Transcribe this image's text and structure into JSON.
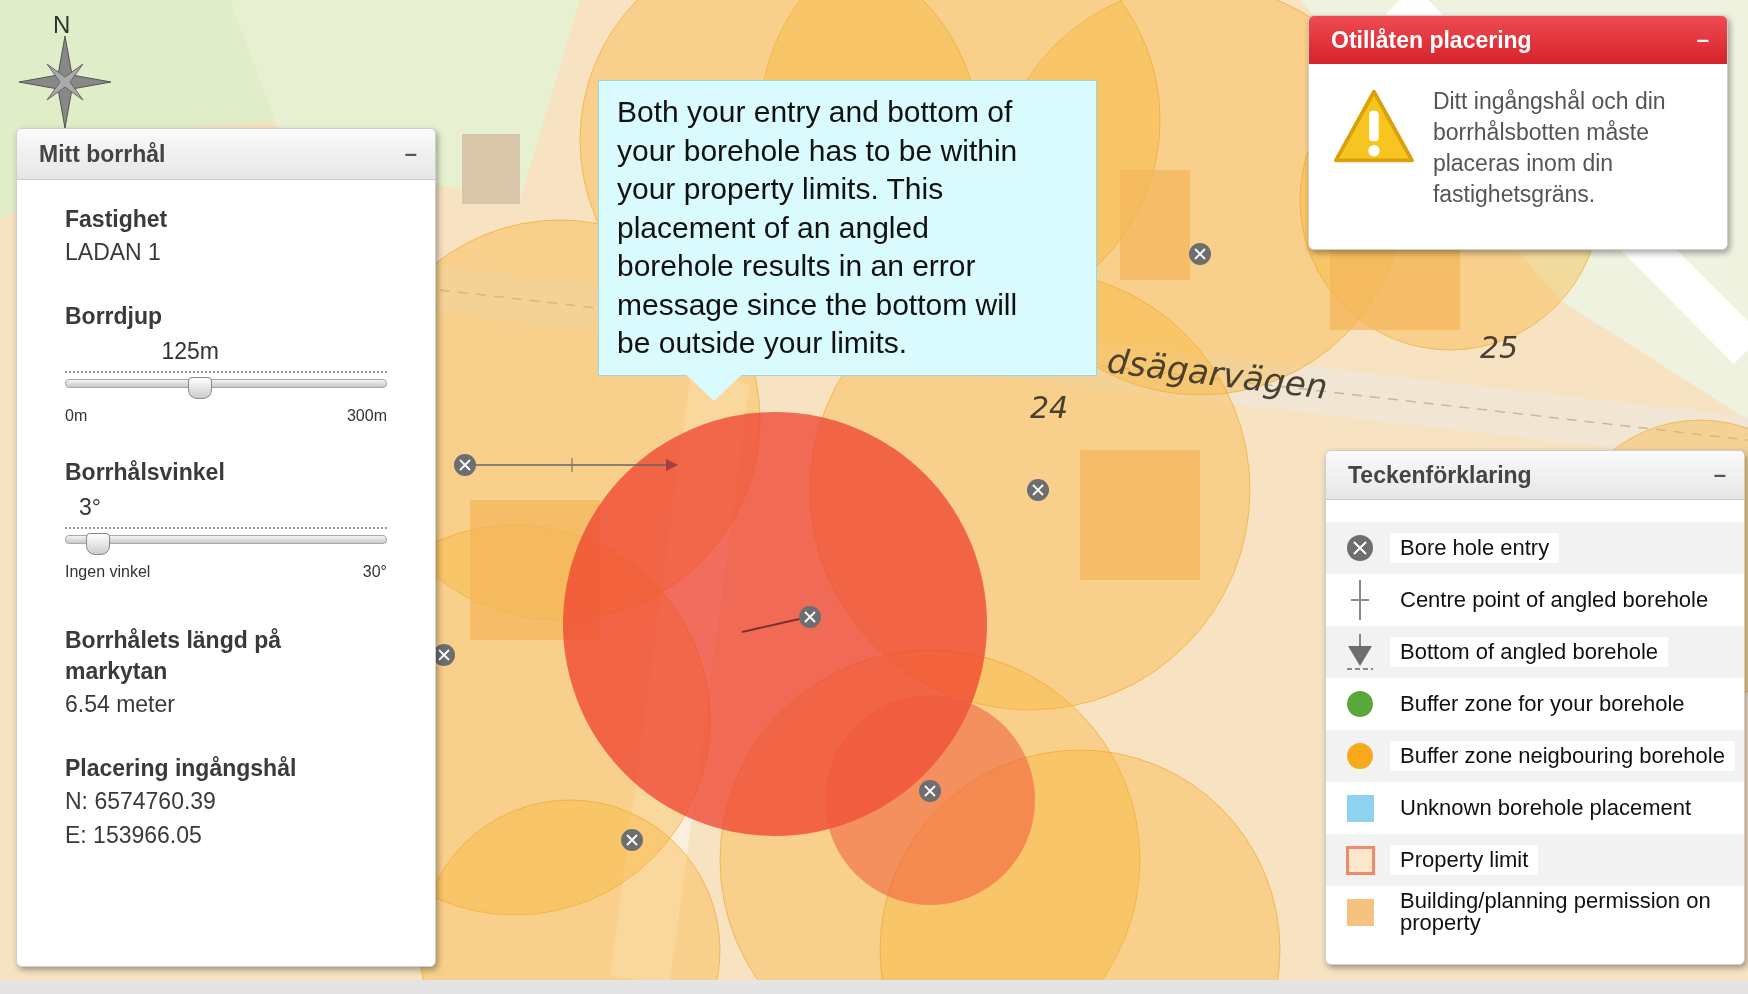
{
  "map": {
    "compass": "N",
    "street_name": "dsägarvägen",
    "house_numbers": [
      "24",
      "25"
    ]
  },
  "borehole_panel": {
    "title": "Mitt borrhål",
    "collapse": "–",
    "property": {
      "label": "Fastighet",
      "value": "LADAN 1"
    },
    "depth": {
      "label": "Borrdjup",
      "reading": "125m",
      "level": 0.417,
      "min": "0m",
      "max": "300m"
    },
    "angle": {
      "label": "Borrhålsvinkel",
      "reading": "3°",
      "level": 0.1,
      "min": "Ingen vinkel",
      "max": "30°"
    },
    "surface_length": {
      "label": "Borrhålets längd på markytan",
      "value": "6.54 meter"
    },
    "entry_position": {
      "label": "Placering ingångshål",
      "values": [
        "N: 6574760.39",
        "E: 153966.05"
      ]
    }
  },
  "callout": {
    "text": "Both your entry and bottom of your borehole has to be within your property limits. This placement of an angled borehole results in an error message since the bottom will be outside your limits."
  },
  "error_panel": {
    "title": "Otillåten placering",
    "collapse": "–",
    "message": "Ditt ingångshål och din borrhålsbotten måste placeras inom din fastighetsgräns."
  },
  "legend": {
    "title": "Teckenförklaring",
    "collapse": "–",
    "items": [
      {
        "kind": "entry",
        "label": "Bore hole entry"
      },
      {
        "kind": "centre",
        "label": "Centre point of angled borehole"
      },
      {
        "kind": "bottom",
        "label": "Bottom of angled borehole"
      },
      {
        "kind": "dot",
        "label": "Buffer zone for your borehole",
        "color": "#5aa83c"
      },
      {
        "kind": "dot",
        "label": "Buffer zone neigbouring borehole",
        "color": "#f7a81b"
      },
      {
        "kind": "square",
        "label": "Unknown borehole placement",
        "color": "#8fd3f0"
      },
      {
        "kind": "outline",
        "label": "Property limit",
        "color": "#f08a6a"
      },
      {
        "kind": "square",
        "label": "Building/planning permission on property",
        "color": "#f5c27f"
      }
    ]
  }
}
